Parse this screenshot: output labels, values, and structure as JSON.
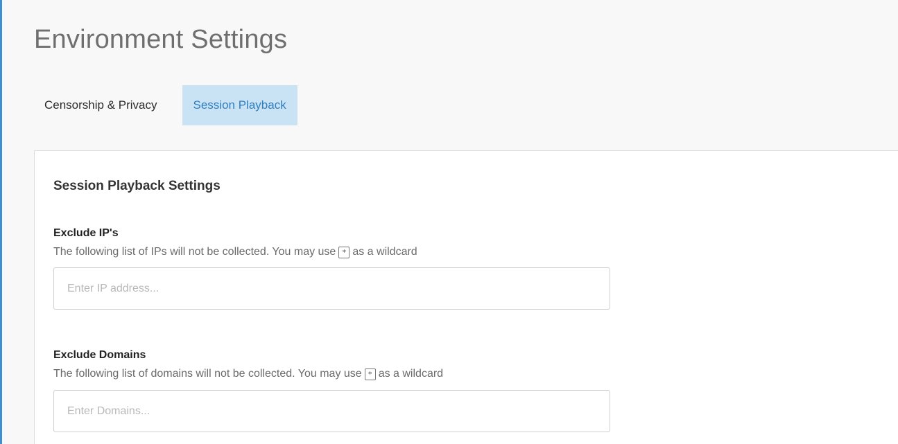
{
  "page": {
    "title": "Environment Settings"
  },
  "tabs": [
    {
      "label": "Censorship & Privacy",
      "active": false
    },
    {
      "label": "Session Playback",
      "active": true
    }
  ],
  "card": {
    "title": "Session Playback Settings"
  },
  "fields": {
    "exclude_ips": {
      "label": "Exclude IP's",
      "help_before": "The following list of IPs will not be collected. You may use",
      "wildcard": "*",
      "help_after": "as a wildcard",
      "value": "",
      "placeholder": "Enter IP address..."
    },
    "exclude_domains": {
      "label": "Exclude Domains",
      "help_before": "The following list of domains will not be collected. You may use",
      "wildcard": "*",
      "help_after": "as a wildcard",
      "value": "",
      "placeholder": "Enter Domains..."
    }
  },
  "colors": {
    "accent": "#3e8ed0",
    "active_tab_bg": "#c9e3f5",
    "active_tab_text": "#2f7fc0"
  }
}
